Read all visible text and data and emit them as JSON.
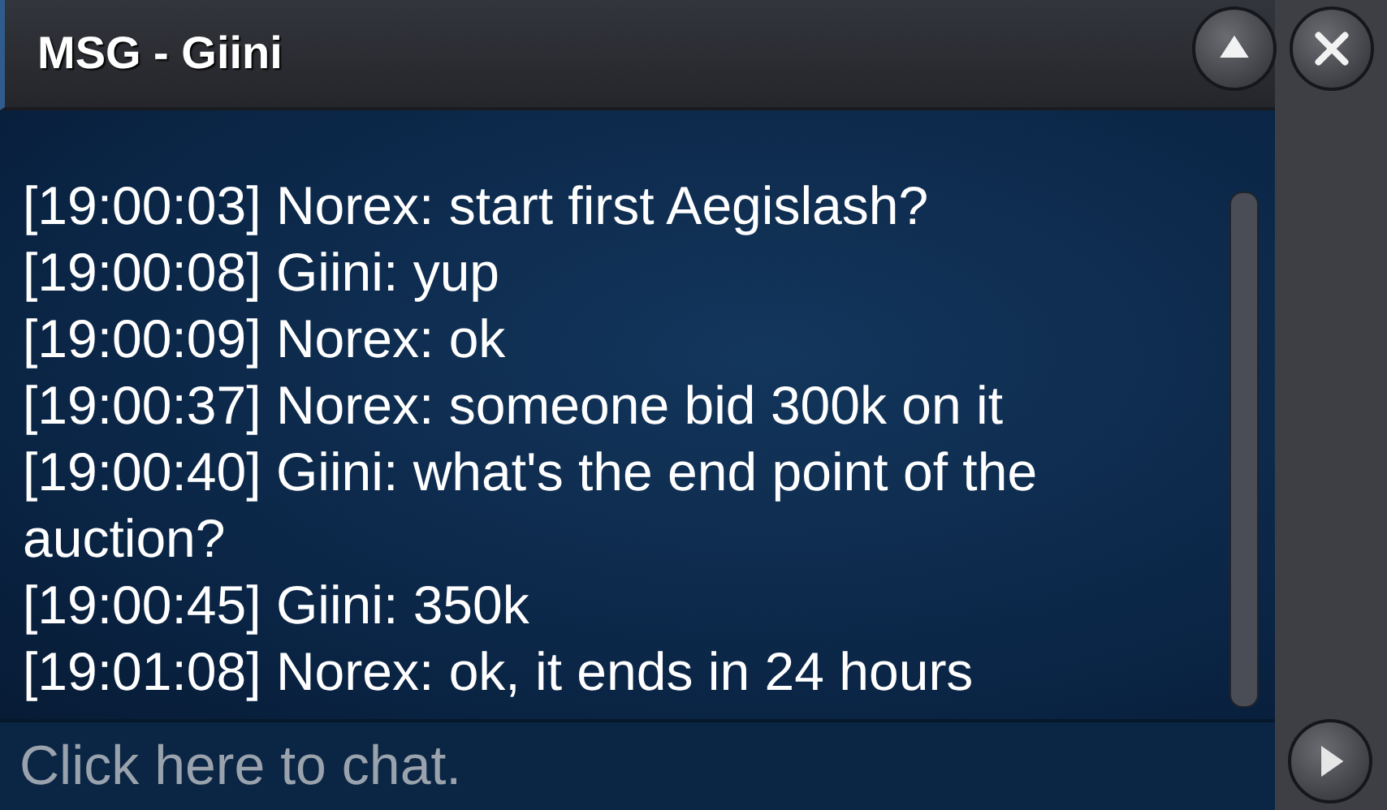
{
  "window": {
    "title": "MSG - Giini"
  },
  "messages": [
    {
      "text": "[19:00:03] Norex: start first Aegislash?"
    },
    {
      "text": "[19:00:08] Giini: yup"
    },
    {
      "text": "[19:00:09] Norex: ok"
    },
    {
      "text": "[19:00:37] Norex: someone bid 300k on it"
    },
    {
      "text": "[19:00:40] Giini: what's the end point of the auction?"
    },
    {
      "text": "[19:00:45] Giini: 350k"
    },
    {
      "text": "[19:01:08] Norex: ok, it ends in 24 hours"
    }
  ],
  "chat_input": {
    "placeholder": "Click here to chat."
  }
}
